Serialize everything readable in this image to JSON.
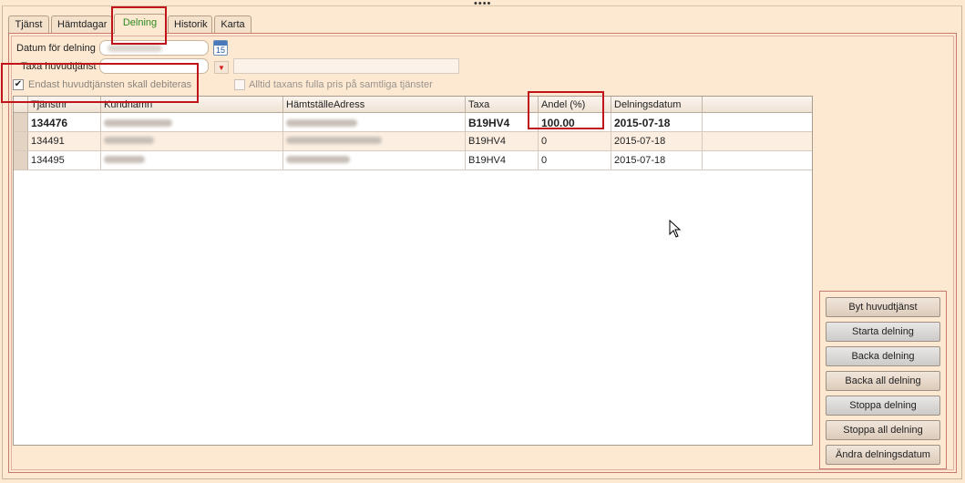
{
  "tabs": [
    "Tjänst",
    "Hämtdagar",
    "Delning",
    "Historik",
    "Karta"
  ],
  "active_tab": "Delning",
  "form": {
    "datum_label": "Datum för delning",
    "datum_value": "",
    "calendar_icon_text": "15",
    "taxa_label": "Taxa huvudtjänst",
    "taxa_value": "",
    "checkbox_endast_label": "Endast huvudtjänsten skall debiteras",
    "checkbox_endast_checked": true,
    "checkbox_alltid_label": "Alltid taxans fulla pris på samtliga tjänster",
    "checkbox_alltid_checked": false
  },
  "grid": {
    "columns": [
      "Tjänstnr",
      "Kundnamn",
      "HämtställeAdress",
      "Taxa",
      "Andel (%)",
      "Delningsdatum"
    ],
    "rows": [
      {
        "tjanstnr": "134476",
        "kundnamn": "",
        "adress": "",
        "taxa": "B19HV4",
        "andel": "100.00",
        "datum": "2015-07-18"
      },
      {
        "tjanstnr": "134491",
        "kundnamn": "",
        "adress": "",
        "taxa": "B19HV4",
        "andel": "0",
        "datum": "2015-07-18"
      },
      {
        "tjanstnr": "134495",
        "kundnamn": "",
        "adress": "",
        "taxa": "B19HV4",
        "andel": "0",
        "datum": "2015-07-18"
      }
    ]
  },
  "buttons": {
    "byt": "Byt huvudtjänst",
    "starta": "Starta delning",
    "backa": "Backa delning",
    "backa_all": "Backa all delning",
    "stoppa": "Stoppa delning",
    "stoppa_all": "Stoppa all delning",
    "andra": "Ändra delningsdatum"
  },
  "colors": {
    "background": "#fde9d2",
    "active_tab_text": "#2d8a1e",
    "highlight_border": "#c0141a"
  }
}
